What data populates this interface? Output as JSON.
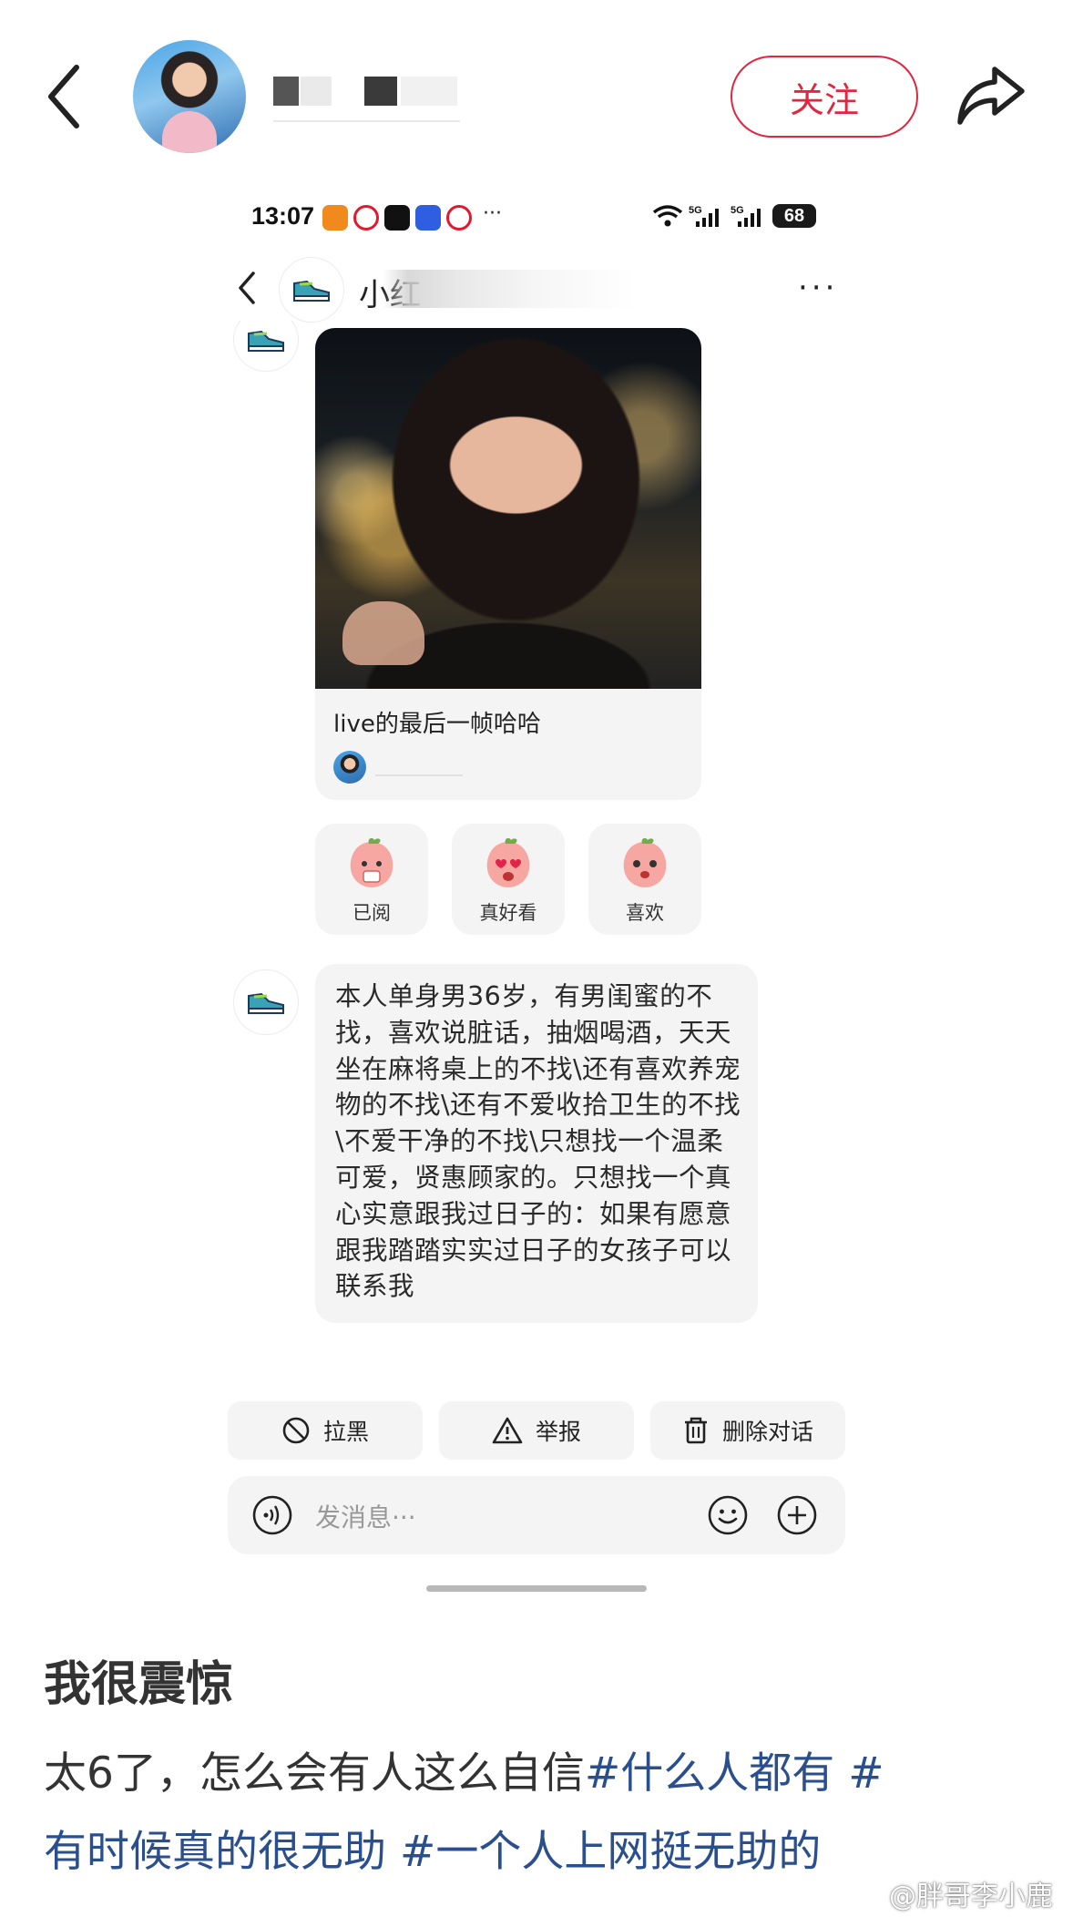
{
  "header": {
    "follow_label": "关注"
  },
  "status_bar": {
    "time": "13:07",
    "more": "···",
    "battery": "68"
  },
  "chat": {
    "title": "小红",
    "more": "···",
    "card": {
      "caption": "live的最后一帧哈哈"
    },
    "reactions": [
      {
        "label": "已阅"
      },
      {
        "label": "真好看"
      },
      {
        "label": "喜欢"
      }
    ],
    "message": "本人单身男36岁，有男闺蜜的不找，喜欢说脏话，抽烟喝酒，天天坐在麻将桌上的不找\\还有喜欢养宠物的不找\\还有不爱收拾卫生的不找\\不爱干净的不找\\只想找一个温柔可爱，贤惠顾家的。只想找一个真心实意跟我过日子的：如果有愿意跟我踏踏实实过日子的女孩子可以联系我",
    "actions": {
      "block": "拉黑",
      "report": "举报",
      "delete": "删除对话"
    },
    "input_placeholder": "发消息···"
  },
  "post": {
    "title": "我很震惊",
    "body_prefix": "太6了，怎么会有人这么自信",
    "tags": [
      "#什么人都有 #",
      "有时候真的很无助",
      " #一个人上网挺无助的"
    ],
    "watermark": "@胖哥李小鹿"
  },
  "colors": {
    "accent": "#e0273f",
    "tag": "#2a4f8c",
    "bubble_bg": "#f4f4f4"
  }
}
